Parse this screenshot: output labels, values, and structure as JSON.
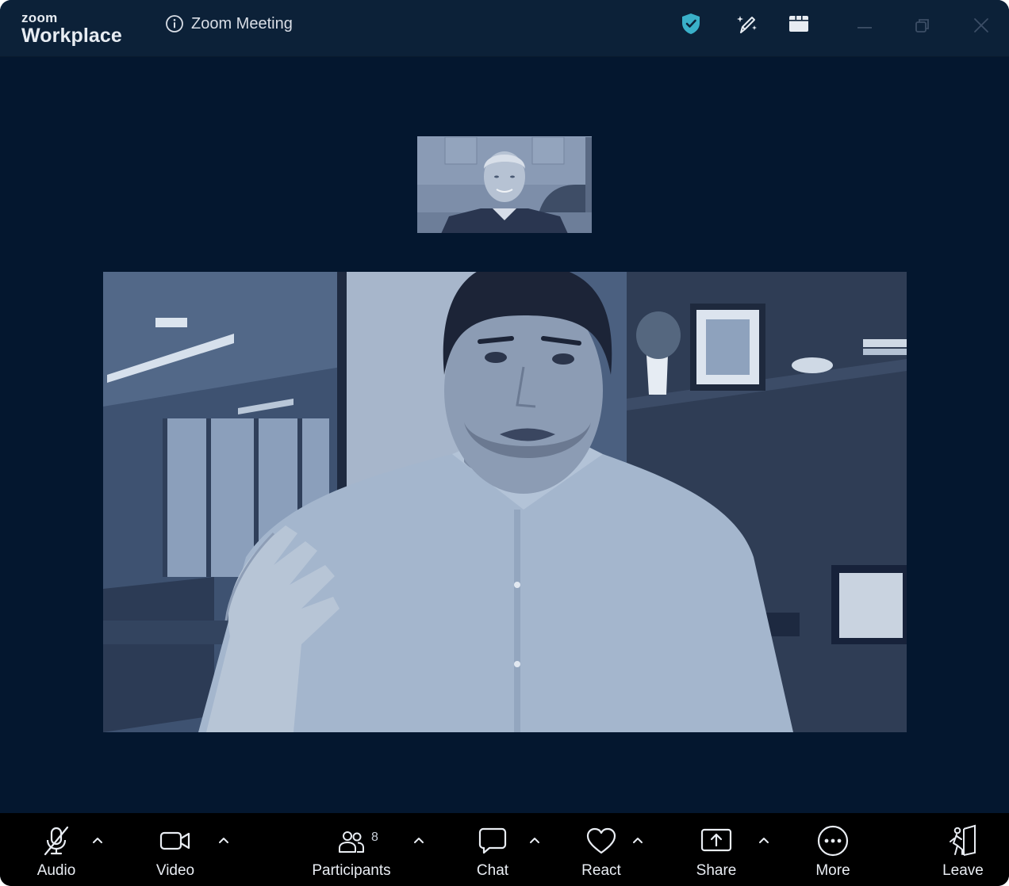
{
  "app": {
    "brand_small": "zoom",
    "brand_large": "Workplace",
    "meeting_title": "Zoom Meeting"
  },
  "colors": {
    "window_bg": "#04172f",
    "titlebar_bg": "#0c2138",
    "toolbar_bg": "#000000",
    "shield_accent": "#3ab0c9",
    "text": "#e9edf3"
  },
  "titlebar_icons": [
    "info-icon",
    "shield-check-icon",
    "sparkle-pen-icon",
    "view-grid-icon",
    "minimize-icon",
    "restore-icon",
    "close-icon"
  ],
  "videos": {
    "thumbnail": "participant-video",
    "main": "active-speaker-video"
  },
  "toolbar": {
    "audio": {
      "label": "Audio",
      "icon": "mic-muted-icon"
    },
    "video": {
      "label": "Video",
      "icon": "camera-icon"
    },
    "participants": {
      "label": "Participants",
      "icon": "people-icon",
      "count": "8"
    },
    "chat": {
      "label": "Chat",
      "icon": "chat-bubble-icon"
    },
    "react": {
      "label": "React",
      "icon": "heart-icon"
    },
    "share": {
      "label": "Share",
      "icon": "share-up-icon"
    },
    "more": {
      "label": "More",
      "icon": "ellipsis-icon"
    },
    "leave": {
      "label": "Leave",
      "icon": "exit-door-icon"
    }
  }
}
